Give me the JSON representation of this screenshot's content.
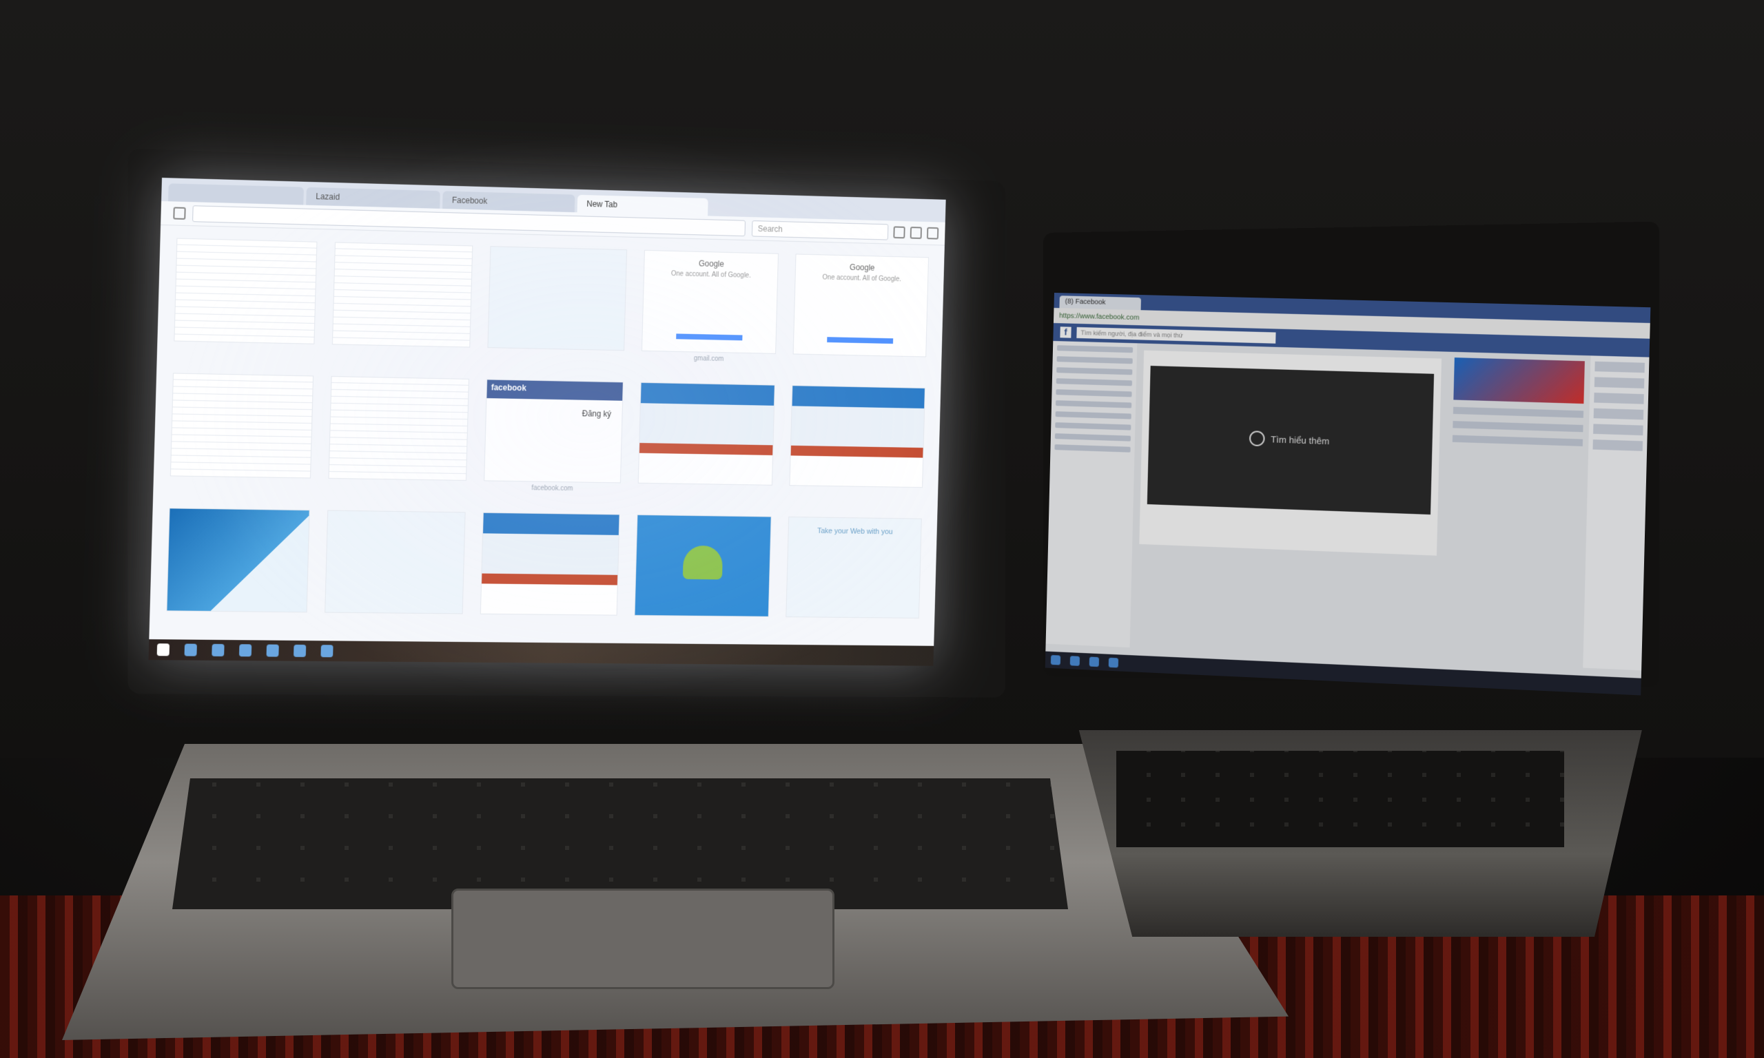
{
  "left_screen": {
    "tabs": [
      {
        "label": "",
        "active": false
      },
      {
        "label": "Lazaid",
        "active": false
      },
      {
        "label": "Facebook",
        "active": false
      },
      {
        "label": "New Tab",
        "active": true
      }
    ],
    "search_placeholder": "Search",
    "tiles": [
      {
        "label": "",
        "kind": "t-page"
      },
      {
        "label": "",
        "kind": "t-page"
      },
      {
        "label": "",
        "kind": "t-light"
      },
      {
        "label": "gmail.com",
        "kind": "google",
        "title": "Google",
        "subtitle": "One account. All of Google."
      },
      {
        "label": "",
        "kind": "google",
        "title": "Google",
        "subtitle": "One account. All of Google."
      },
      {
        "label": "",
        "kind": "t-page"
      },
      {
        "label": "",
        "kind": "t-page"
      },
      {
        "label": "facebook.com",
        "kind": "facebook",
        "title": "facebook",
        "extra": "Đăng ký"
      },
      {
        "label": "",
        "kind": "t-web"
      },
      {
        "label": "",
        "kind": "t-web"
      },
      {
        "label": "",
        "kind": "t-site"
      },
      {
        "label": "",
        "kind": "t-light"
      },
      {
        "label": "",
        "kind": "t-web"
      },
      {
        "label": "",
        "kind": "t-android"
      },
      {
        "label": "",
        "kind": "promo",
        "title": "Take your Web with you"
      }
    ]
  },
  "right_screen": {
    "tab_label": "(8) Facebook",
    "address": "https://www.facebook.com",
    "search_placeholder": "Tìm kiếm người, địa điểm và mọi thứ",
    "video_label": "Tìm hiểu thêm",
    "fb_letter": "f"
  },
  "colors": {
    "facebook_blue": "#3b5998",
    "google_blue": "#4d90fe"
  }
}
